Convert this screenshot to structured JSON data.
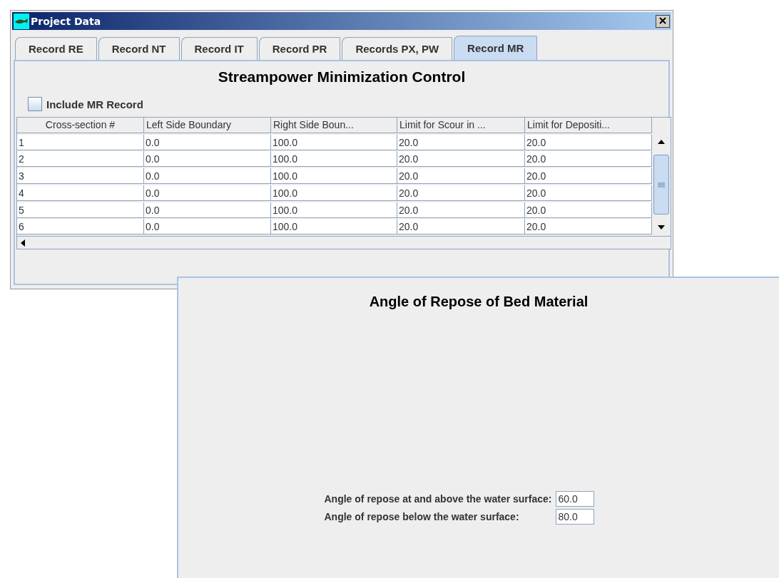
{
  "window": {
    "title": "Project Data"
  },
  "tabs": [
    {
      "label": "Record RE",
      "selected": false
    },
    {
      "label": "Record NT",
      "selected": false
    },
    {
      "label": "Record IT",
      "selected": false
    },
    {
      "label": "Record PR",
      "selected": false
    },
    {
      "label": "Records PX, PW",
      "selected": false
    },
    {
      "label": "Record MR",
      "selected": true
    }
  ],
  "heading": "Streampower Minimization Control",
  "include_checkbox": {
    "label": "Include MR Record",
    "checked": false
  },
  "table": {
    "columns": [
      "Cross-section #",
      "Left Side Boundary",
      "Right Side Boun...",
      "Limit for Scour in ...",
      "Limit for Depositi..."
    ],
    "rows": [
      [
        "1",
        "0.0",
        "100.0",
        "20.0",
        "20.0"
      ],
      [
        "2",
        "0.0",
        "100.0",
        "20.0",
        "20.0"
      ],
      [
        "3",
        "0.0",
        "100.0",
        "20.0",
        "20.0"
      ],
      [
        "4",
        "0.0",
        "100.0",
        "20.0",
        "20.0"
      ],
      [
        "5",
        "0.0",
        "100.0",
        "20.0",
        "20.0"
      ],
      [
        "6",
        "0.0",
        "100.0",
        "20.0",
        "20.0"
      ]
    ]
  },
  "repose_panel": {
    "title": "Angle of Repose of Bed Material",
    "fields": [
      {
        "label": "Angle of repose at and above the water surface:",
        "value": "60.0"
      },
      {
        "label": "Angle of repose below the water surface:",
        "value": "80.0"
      }
    ]
  }
}
